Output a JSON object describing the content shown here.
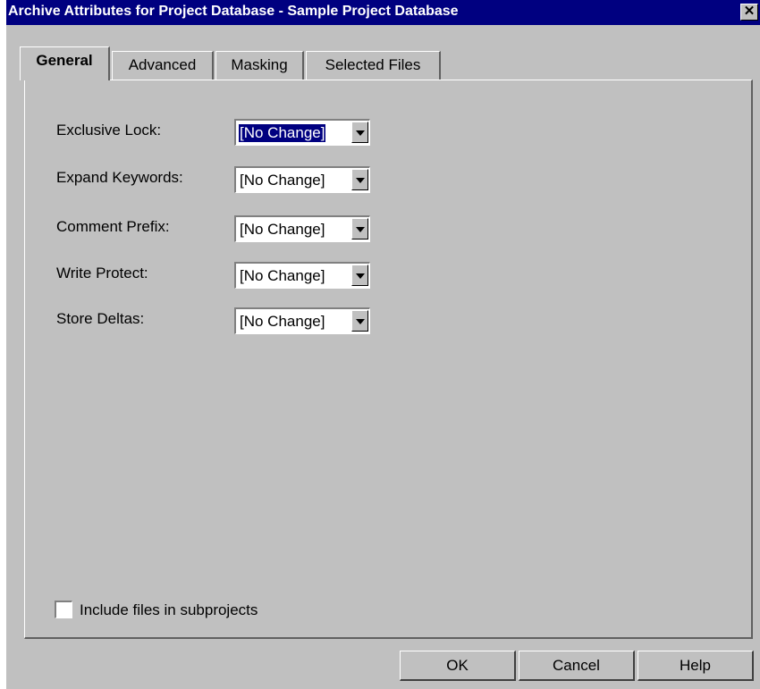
{
  "window": {
    "title": "Archive Attributes for Project Database - Sample Project Database",
    "close_glyph": "✕"
  },
  "tabs": [
    {
      "label": "General",
      "active": true
    },
    {
      "label": "Advanced",
      "active": false
    },
    {
      "label": "Masking",
      "active": false
    },
    {
      "label": "Selected Files",
      "active": false
    }
  ],
  "fields": [
    {
      "label": "Exclusive Lock:",
      "value": "[No Change]"
    },
    {
      "label": "Expand Keywords:",
      "value": "[No Change]"
    },
    {
      "label": "Comment Prefix:",
      "value": "[No Change]"
    },
    {
      "label": "Write Protect:",
      "value": "[No Change]"
    },
    {
      "label": "Store Deltas:",
      "value": "[No Change]"
    }
  ],
  "include_subprojects": {
    "label": "Include files in subprojects",
    "checked": false
  },
  "buttons": {
    "ok": "OK",
    "cancel": "Cancel",
    "help": "Help"
  },
  "colors": {
    "titlebar": "#000080",
    "face": "#c0c0c0",
    "selection": "#000080"
  }
}
